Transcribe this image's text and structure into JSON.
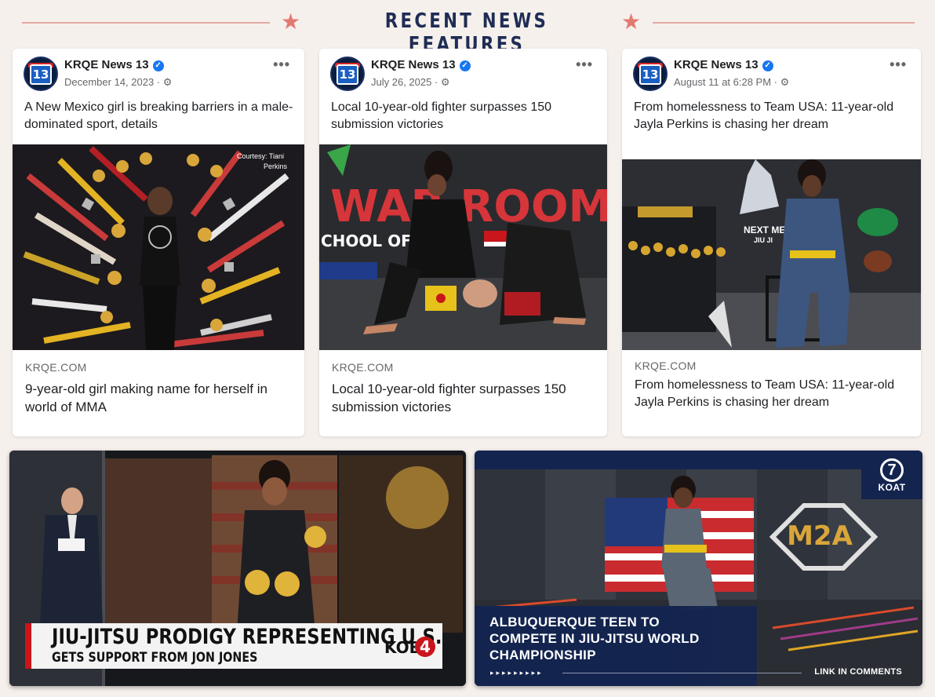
{
  "header": {
    "title": "RECENT NEWS FEATURES"
  },
  "posts": [
    {
      "page_name": "KRQE News 13",
      "avatar_text": "13",
      "date": "December 14, 2023 · ",
      "caption": "A New Mexico girl is breaking barriers in a male-dominated sport, details",
      "photo_credit": "Courtesy: Tiani Perkins",
      "link_domain": "KRQE.COM",
      "link_title": "9-year-old girl making name for herself in world of MMA"
    },
    {
      "page_name": "KRQE News 13",
      "avatar_text": "13",
      "date": "July 26, 2025 · ",
      "caption": "Local 10-year-old fighter surpasses 150 submission victories",
      "photo_sign_1": "WAR ROOM",
      "photo_sign_2": "CHOOL OF",
      "link_domain": "KRQE.COM",
      "link_title": "Local 10-year-old fighter surpasses 150 submission victories"
    },
    {
      "page_name": "KRQE News 13",
      "avatar_text": "13",
      "date": "August 11 at 6:28 PM · ",
      "caption": "From homelessness to Team USA: 11-year-old Jayla Perkins is chasing her dream",
      "photo_sign": "NEXT ME",
      "photo_sign_2": "JIU JI",
      "link_domain": "KRQE.COM",
      "link_title": "From homelessness to Team USA: 11-year-old Jayla Perkins is chasing her dream"
    }
  ],
  "kob_segment": {
    "headline": "JIU-JITSU PRODIGY REPRESENTING U.S.",
    "subhead": "GETS SUPPORT FROM JON JONES",
    "station": "KOB",
    "channel": "4"
  },
  "koat_segment": {
    "station": "KOAT",
    "channel": "7",
    "headline": "ALBUQUERQUE TEEN TO COMPETE IN JIU-JITSU WORLD CHAMPIONSHIP",
    "arrows": "▸▸▸▸▸▸▸▸▸",
    "link_text": "LINK IN COMMENTS",
    "wall_logo": "M2A"
  },
  "icons": {
    "verified": "verified-badge-icon",
    "audience": "gear-icon",
    "more": "more-options-icon",
    "star": "star-icon"
  },
  "colors": {
    "accent_navy": "#1f2d55",
    "accent_red": "#e27a72",
    "fb_blue": "#1877f2",
    "kob_red": "#c8161c",
    "koat_navy": "#13244f"
  }
}
